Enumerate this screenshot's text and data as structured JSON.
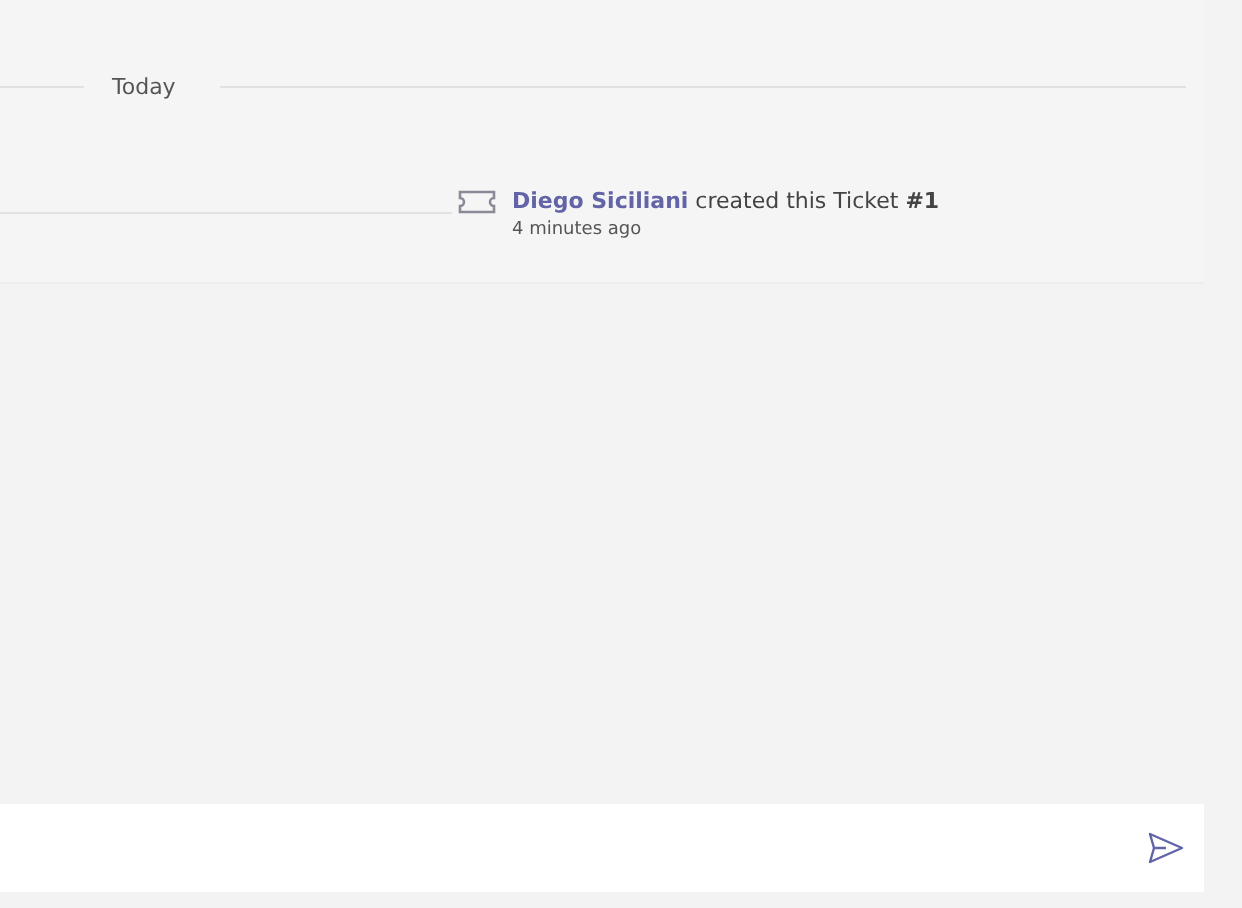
{
  "date_divider": {
    "label": "Today"
  },
  "activity": {
    "actor": "Diego Siciliani",
    "text": "created this Ticket **#1**",
    "time": "4 minutes ago"
  }
}
